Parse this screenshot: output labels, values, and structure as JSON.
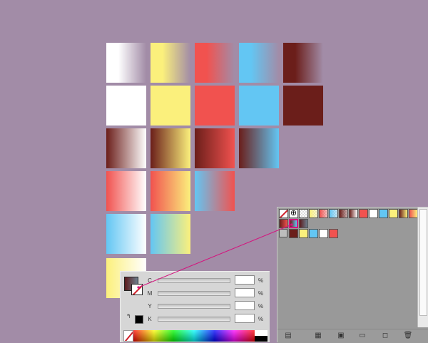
{
  "color_panel": {
    "channels": [
      {
        "label": "C",
        "value": "",
        "unit": "%"
      },
      {
        "label": "M",
        "value": "",
        "unit": "%"
      },
      {
        "label": "Y",
        "value": "",
        "unit": "%"
      },
      {
        "label": "K",
        "value": "",
        "unit": "%"
      }
    ]
  },
  "colors": {
    "background": "#a28ca7",
    "white": "#ffffff",
    "yellow": "#fbf07c",
    "red": "#f1524f",
    "blue": "#63c6f3",
    "maroon": "#6b1e1a",
    "accent_line": "#d4147e"
  },
  "icons": {
    "bottom_bar": [
      "swatch-libraries-icon",
      "show-kinds-icon",
      "swatch-options-icon",
      "new-color-group-icon",
      "new-swatch-icon",
      "delete-swatch-icon"
    ]
  }
}
